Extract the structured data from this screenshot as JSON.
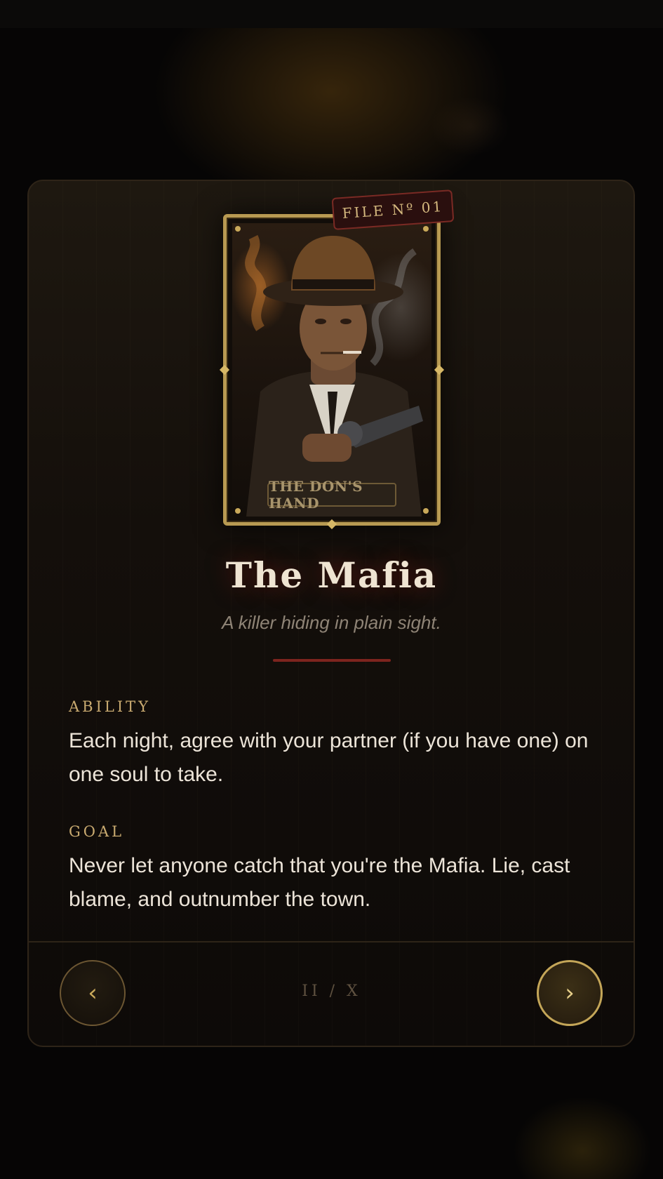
{
  "card": {
    "file_tag": "FILE Nº 01",
    "plate_label": "THE DON'S HAND"
  },
  "role": {
    "title": "The Mafia",
    "subtitle": "A killer hiding in plain sight."
  },
  "ability": {
    "label": "ABILITY",
    "text": "Each night, agree with your partner (if you have one) on one soul to take."
  },
  "goal": {
    "label": "GOAL",
    "text": "Never let anyone catch that you're the Mafia. Lie, cast blame, and outnumber the town."
  },
  "navigation": {
    "prev_label": "‹",
    "next_label": "›",
    "counter": "II / X"
  },
  "colors": {
    "accent_gold": "#c4a658",
    "accent_red": "#7d241e",
    "background": "#070605"
  },
  "icons": {
    "prev": "chevron-left-icon",
    "next": "chevron-right-icon"
  }
}
